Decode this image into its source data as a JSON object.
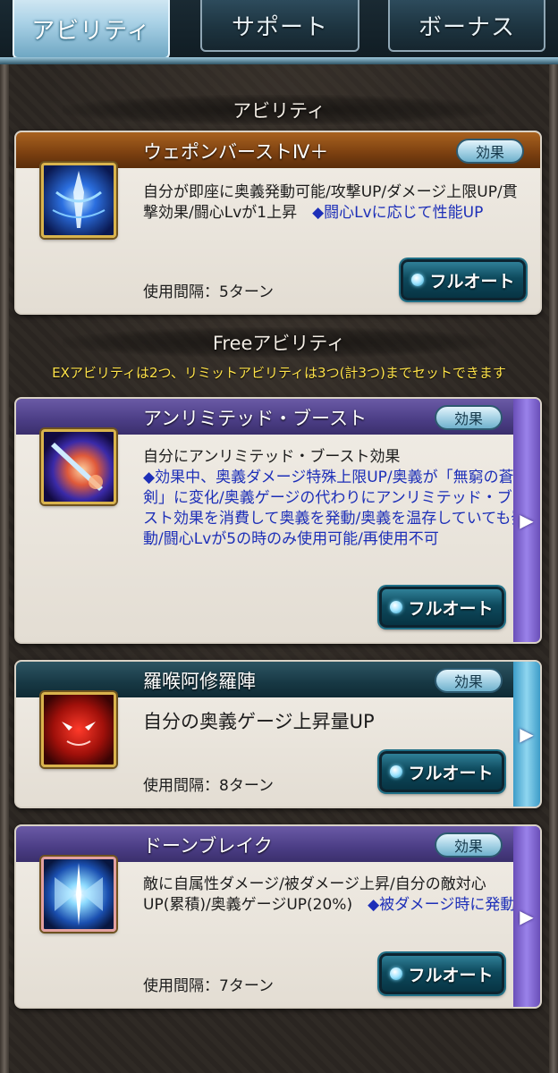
{
  "tabs": [
    {
      "label": "アビリティ",
      "active": true
    },
    {
      "label": "サポート",
      "active": false
    },
    {
      "label": "ボーナス",
      "active": false
    }
  ],
  "sections": {
    "ability_title": "アビリティ",
    "free_title": "Freeアビリティ",
    "notice": "EXアビリティは2つ、リミットアビリティは3つ(計3つ)までセットできます"
  },
  "effect_label": "効果",
  "fullauto_label": "フルオート",
  "cards": [
    {
      "name": "ウェポンバーストⅣ＋",
      "desc_main": "自分が即座に奥義発動可能/攻撃UP/ダメージ上限UP/貫撃効果/闘心Lvが1上昇　",
      "desc_highlight": "◆闘心Lvに応じて性能UP",
      "usage": "使用間隔：5ターン",
      "icon": "sword-burst-icon"
    },
    {
      "name": "アンリミテッド・ブースト",
      "desc_main": "自分にアンリミテッド・ブースト効果",
      "desc_highlight": "◆効果中、奥義ダメージ特殊上限UP/奥義が「無窮の蒼剣」に変化/奥義ゲージの代わりにアンリミテッド・ブースト効果を消費して奥義を発動/奥義を温存していても発動/闘心Lvが5の時のみ使用可能/再使用不可",
      "usage": "",
      "icon": "unlimited-boost-icon"
    },
    {
      "name": "羅喉阿修羅陣",
      "desc_main": "自分の奥義ゲージ上昇量UP",
      "desc_highlight": "",
      "usage": "使用間隔：8ターン",
      "icon": "demon-face-icon"
    },
    {
      "name": "ドーンブレイク",
      "desc_main": "敵に自属性ダメージ/被ダメージ上昇/自分の敵対心UP(累積)/奥義ゲージUP(20%)　",
      "desc_highlight": "◆被ダメージ時に発動",
      "usage": "使用間隔：7ターン",
      "icon": "dawn-break-icon"
    }
  ],
  "side_arrow": "▶",
  "colors": {
    "accent_blue": "#1d2fb8",
    "notice_yellow": "#ffe34a"
  }
}
